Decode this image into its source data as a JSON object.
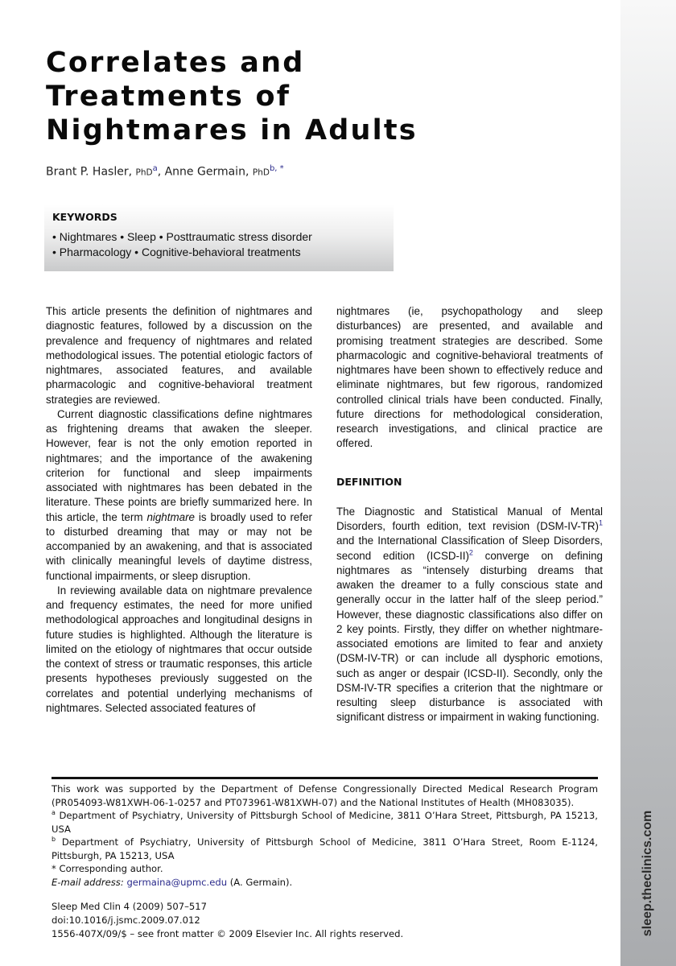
{
  "article": {
    "title_lines": [
      "Correlates and",
      "Treatments of",
      "Nightmares in Adults"
    ],
    "authors": [
      {
        "name": "Brant P. Hasler,",
        "degree": "PhD",
        "affil": "a",
        "sep": ", "
      },
      {
        "name": "Anne Germain,",
        "degree": "PhD",
        "affil": "b, *",
        "sep": ""
      }
    ]
  },
  "keywords": {
    "heading": "KEYWORDS",
    "lines": [
      "• Nightmares • Sleep • Posttraumatic stress disorder",
      "• Pharmacology • Cognitive-behavioral treatments"
    ]
  },
  "body": {
    "left": {
      "p1": "This article presents the definition of nightmares and diagnostic features, followed by a discussion on the prevalence and frequency of nightmares and related methodological issues. The potential etiologic factors of nightmares, associated features, and available pharmacologic and cognitive-behavioral treatment strategies are reviewed.",
      "p2_a": "Current diagnostic classifications define nightmares as frightening dreams that awaken the sleeper. However, fear is not the only emotion reported in nightmares; and the importance of the awakening criterion for functional and sleep impairments associated with nightmares has been debated in the literature. These points are briefly summarized here. In this article, the term ",
      "p2_em": "nightmare",
      "p2_b": " is broadly used to refer to disturbed dreaming that may or may not be accompanied by an awakening, and that is associated with clinically meaningful levels of daytime distress, functional impairments, or sleep disruption.",
      "p3": "In reviewing available data on nightmare prevalence and frequency estimates, the need for more unified methodological approaches and longitudinal designs in future studies is highlighted. Although the literature is limited on the etiology of nightmares that occur outside the context of stress or traumatic responses, this article presents hypotheses previously suggested on the correlates and potential underlying mechanisms of nightmares. Selected associated features of"
    },
    "right": {
      "p1": "nightmares (ie, psychopathology and sleep disturbances) are presented, and available and promising treatment strategies are described. Some pharmacologic and cognitive-behavioral treatments of nightmares have been shown to effectively reduce and eliminate nightmares, but few rigorous, randomized controlled clinical trials have been conducted. Finally, future directions for methodological consideration, research investigations, and clinical practice are offered.",
      "section_heading": "DEFINITION",
      "def_a": "The Diagnostic and Statistical Manual of Mental Disorders, fourth edition, text revision (DSM-IV-TR)",
      "ref1": "1",
      "def_b": " and the International Classification of Sleep Disorders, second edition (ICSD-II)",
      "ref2": "2",
      "def_c": " converge on defining nightmares as “intensely disturbing dreams that awaken the dreamer to a fully conscious state and generally occur in the latter half of the sleep period.” However, these diagnostic classifications also differ on 2 key points. Firstly, they differ on whether nightmare-associated emotions are limited to fear and anxiety (DSM-IV-TR) or can include all dysphoric emotions, such as anger or despair (ICSD-II). Secondly, only the DSM-IV-TR specifies a criterion that the nightmare or resulting sleep disturbance is associated with significant distress or impairment in waking functioning."
    }
  },
  "footnotes": {
    "funding": "This work was supported by the Department of Defense Congressionally Directed Medical Research Program (PR054093-W81XWH-06-1-0257 and PT073961-W81XWH-07) and the National Institutes of Health (MH083035).",
    "affil_a_mark": "a",
    "affil_a": " Department of Psychiatry, University of Pittsburgh School of Medicine, 3811 O’Hara Street, Pittsburgh, PA 15213, USA",
    "affil_b_mark": "b",
    "affil_b": " Department of Psychiatry, University of Pittsburgh School of Medicine, 3811 O’Hara Street, Room E-1124, Pittsburgh, PA 15213, USA",
    "corresponding": "* Corresponding author.",
    "email_label": "E-mail address:",
    "email": "germaina@upmc.edu",
    "email_suffix": " (A. Germain)."
  },
  "citation": {
    "journal": "Sleep Med Clin 4 (2009) 507–517",
    "doi": "doi:10.1016/j.jsmc.2009.07.012",
    "copyright": "1556-407X/09/$ – see front matter © 2009 Elsevier Inc. All rights reserved."
  },
  "sidebar": {
    "url": "sleep.theclinics.com"
  }
}
